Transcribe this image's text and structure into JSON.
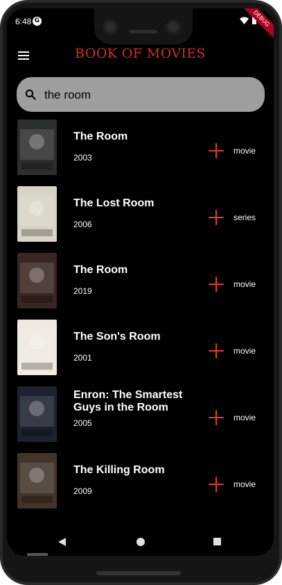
{
  "status": {
    "time": "6:48",
    "badge": "DEBUG"
  },
  "appbar": {
    "title": "BOOK OF MOVIES"
  },
  "search": {
    "value": "the room"
  },
  "results": [
    {
      "title": "The Room",
      "year": "2003",
      "type": "movie",
      "poster_label": "THE ROOM",
      "poster_bg": "#2b2f2e"
    },
    {
      "title": "The Lost Room",
      "year": "2006",
      "type": "series",
      "poster_label": "lost room",
      "poster_bg": "#d8d3c4"
    },
    {
      "title": "The Room",
      "year": "2019",
      "type": "movie",
      "poster_label": "ROOM",
      "poster_bg": "#3a2622"
    },
    {
      "title": "The Son's Room",
      "year": "2001",
      "type": "movie",
      "poster_label": "la stanza del figlio",
      "poster_bg": "#efe9df"
    },
    {
      "title": "Enron: The Smartest Guys in the Room",
      "year": "2005",
      "type": "movie",
      "poster_label": "ENRON",
      "poster_bg": "#1d2230"
    },
    {
      "title": "The Killing Room",
      "year": "2009",
      "type": "movie",
      "poster_label": "KILLING ROOM",
      "poster_bg": "#43342a"
    }
  ],
  "colors": {
    "accent": "#d52b2b",
    "background": "#000000",
    "search_bg": "#9e9e9e"
  }
}
